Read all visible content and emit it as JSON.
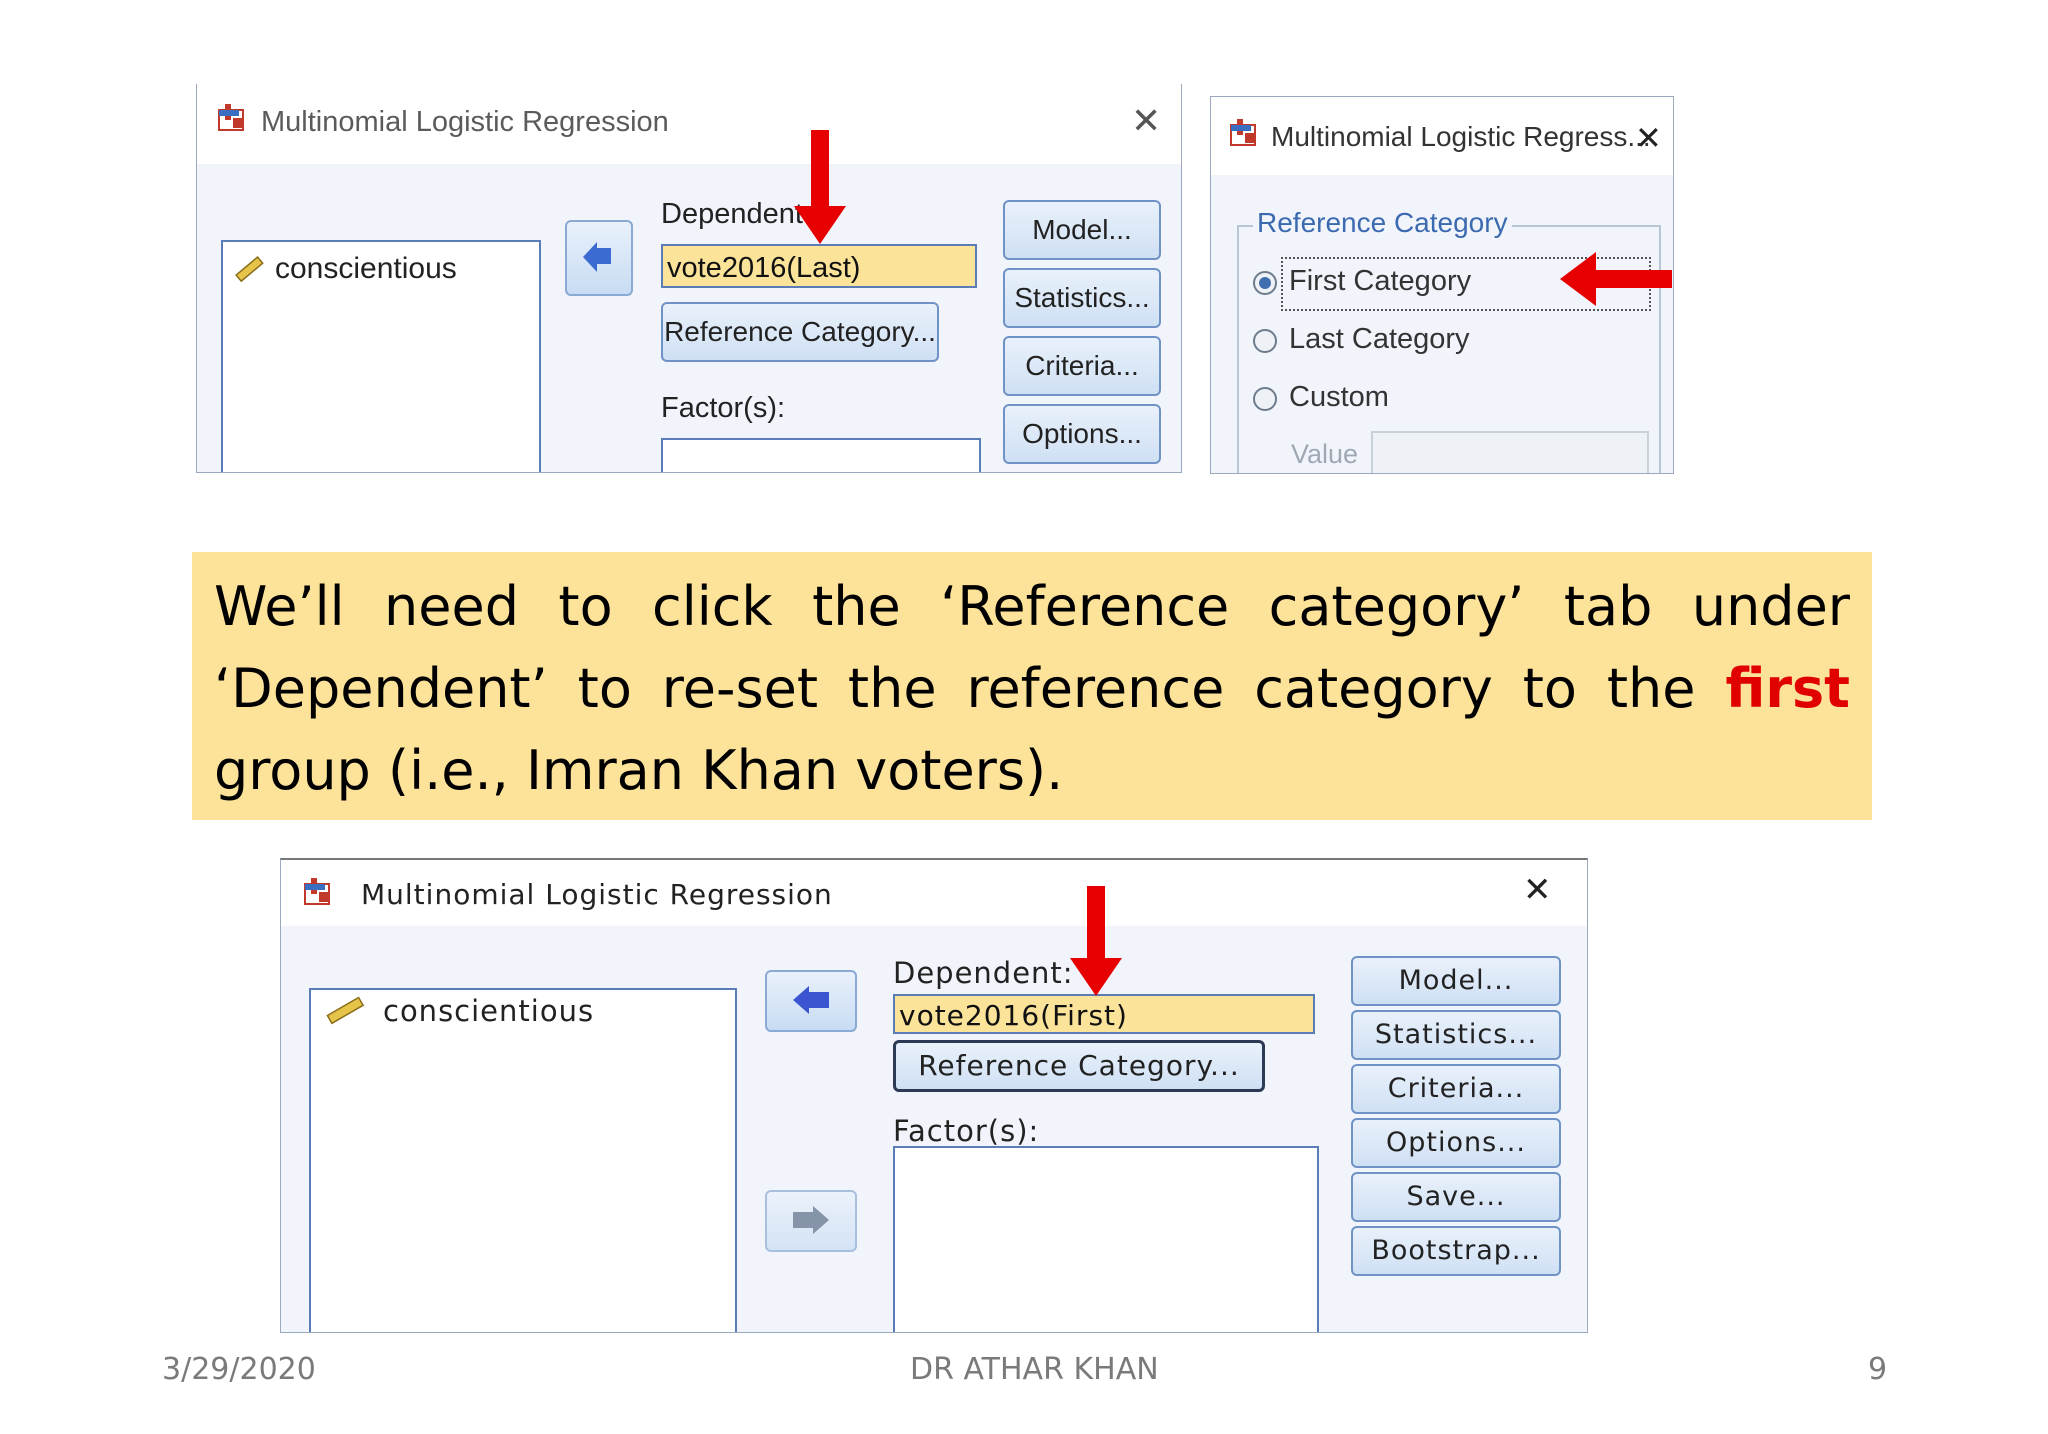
{
  "top_dialog": {
    "title": "Multinomial Logistic Regression",
    "variable": "conscientious",
    "dependent_label": "Dependent:",
    "dependent_value": "vote2016(Last)",
    "reference_button": "Reference Category...",
    "factors_label": "Factor(s):",
    "buttons": [
      "Model...",
      "Statistics...",
      "Criteria...",
      "Options..."
    ]
  },
  "ref_dialog": {
    "title": "Multinomial Logistic Regress...",
    "group_label": "Reference Category",
    "options": [
      "First Category",
      "Last Category",
      "Custom"
    ],
    "selected_option": "First Category",
    "value_label": "Value"
  },
  "callout": {
    "text_before": "We’ll need to click the ‘Reference category’ tab under ‘Dependent’ to re-set the reference category to the ",
    "highlight": "first",
    "text_after": " group (i.e., Imran Khan voters).",
    "highlight_color": "#e00000",
    "background": "#fde39a"
  },
  "bottom_dialog": {
    "title": "Multinomial Logistic Regression",
    "variable": "conscientious",
    "dependent_label": "Dependent:",
    "dependent_value": "vote2016(First)",
    "reference_button": "Reference Category...",
    "factors_label": "Factor(s):",
    "buttons": [
      "Model...",
      "Statistics...",
      "Criteria...",
      "Options...",
      "Save...",
      "Bootstrap..."
    ]
  },
  "footer": {
    "date": "3/29/2020",
    "author": "DR ATHAR KHAN",
    "page": "9"
  },
  "colors": {
    "arrow_red": "#e60000",
    "field_yellow": "#fbe39a",
    "dialog_bg": "#f1f5fb"
  }
}
